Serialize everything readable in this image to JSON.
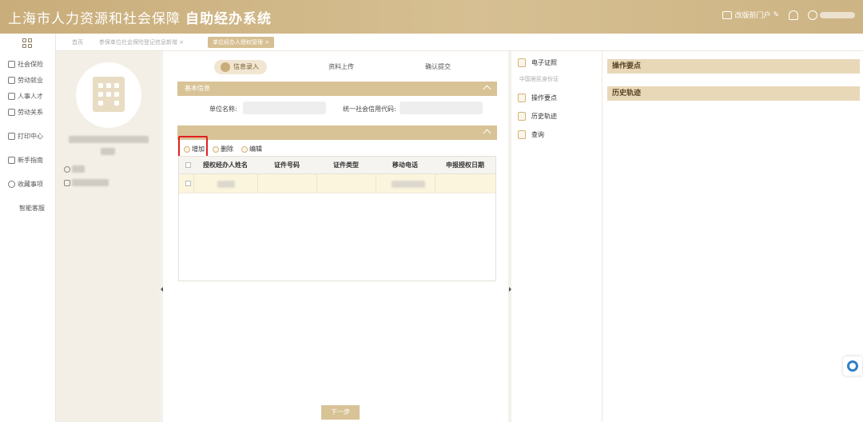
{
  "header": {
    "title_main": "上海市人力资源和社会保障",
    "title_bold": "自助经办系统",
    "portal_label": "改版前门户",
    "colors": {
      "primary": "#c9ad7a",
      "accent_red": "#e02020"
    }
  },
  "sidebar": {
    "items": [
      {
        "label": "社会保险",
        "icon": "shield-icon"
      },
      {
        "label": "劳动就业",
        "icon": "person-icon"
      },
      {
        "label": "人事人才",
        "icon": "people-icon"
      },
      {
        "label": "劳动关系",
        "icon": "document-icon"
      },
      {
        "label": "打印中心",
        "icon": "printer-icon"
      },
      {
        "label": "新手指南",
        "icon": "guide-icon"
      },
      {
        "label": "收藏事项",
        "icon": "star-icon"
      },
      {
        "label": "智能客服",
        "icon": ""
      }
    ]
  },
  "tabs": [
    {
      "label": "首页"
    },
    {
      "label": "参保单位社会保险登记信息新增",
      "close": "×"
    },
    {
      "label": "单位经办人授权管理",
      "close": "×"
    }
  ],
  "steps": [
    {
      "label": "信息录入"
    },
    {
      "label": "资料上传"
    },
    {
      "label": "确认提交"
    }
  ],
  "basic_info": {
    "header": "基本信息",
    "unit_name_label": "单位名称:",
    "credit_code_label": "统一社会信用代码:"
  },
  "authorization": {
    "toolbar": {
      "add": "增加",
      "delete": "删除",
      "edit": "编辑"
    },
    "columns": [
      "授权经办人姓名",
      "证件号码",
      "证件类型",
      "移动电话",
      "申报授权日期"
    ]
  },
  "next_button": "下一步",
  "right_panel": {
    "items": [
      {
        "label": "电子证照",
        "icon": "certificate-icon"
      },
      {
        "label": "操作要点",
        "icon": "note-icon"
      },
      {
        "label": "历史轨迹",
        "icon": "history-icon"
      },
      {
        "label": "查询",
        "icon": "search-icon"
      }
    ],
    "sub_label": "中国居民身份证"
  },
  "details": {
    "section_1": "操作要点",
    "section_2": "历史轨迹"
  }
}
